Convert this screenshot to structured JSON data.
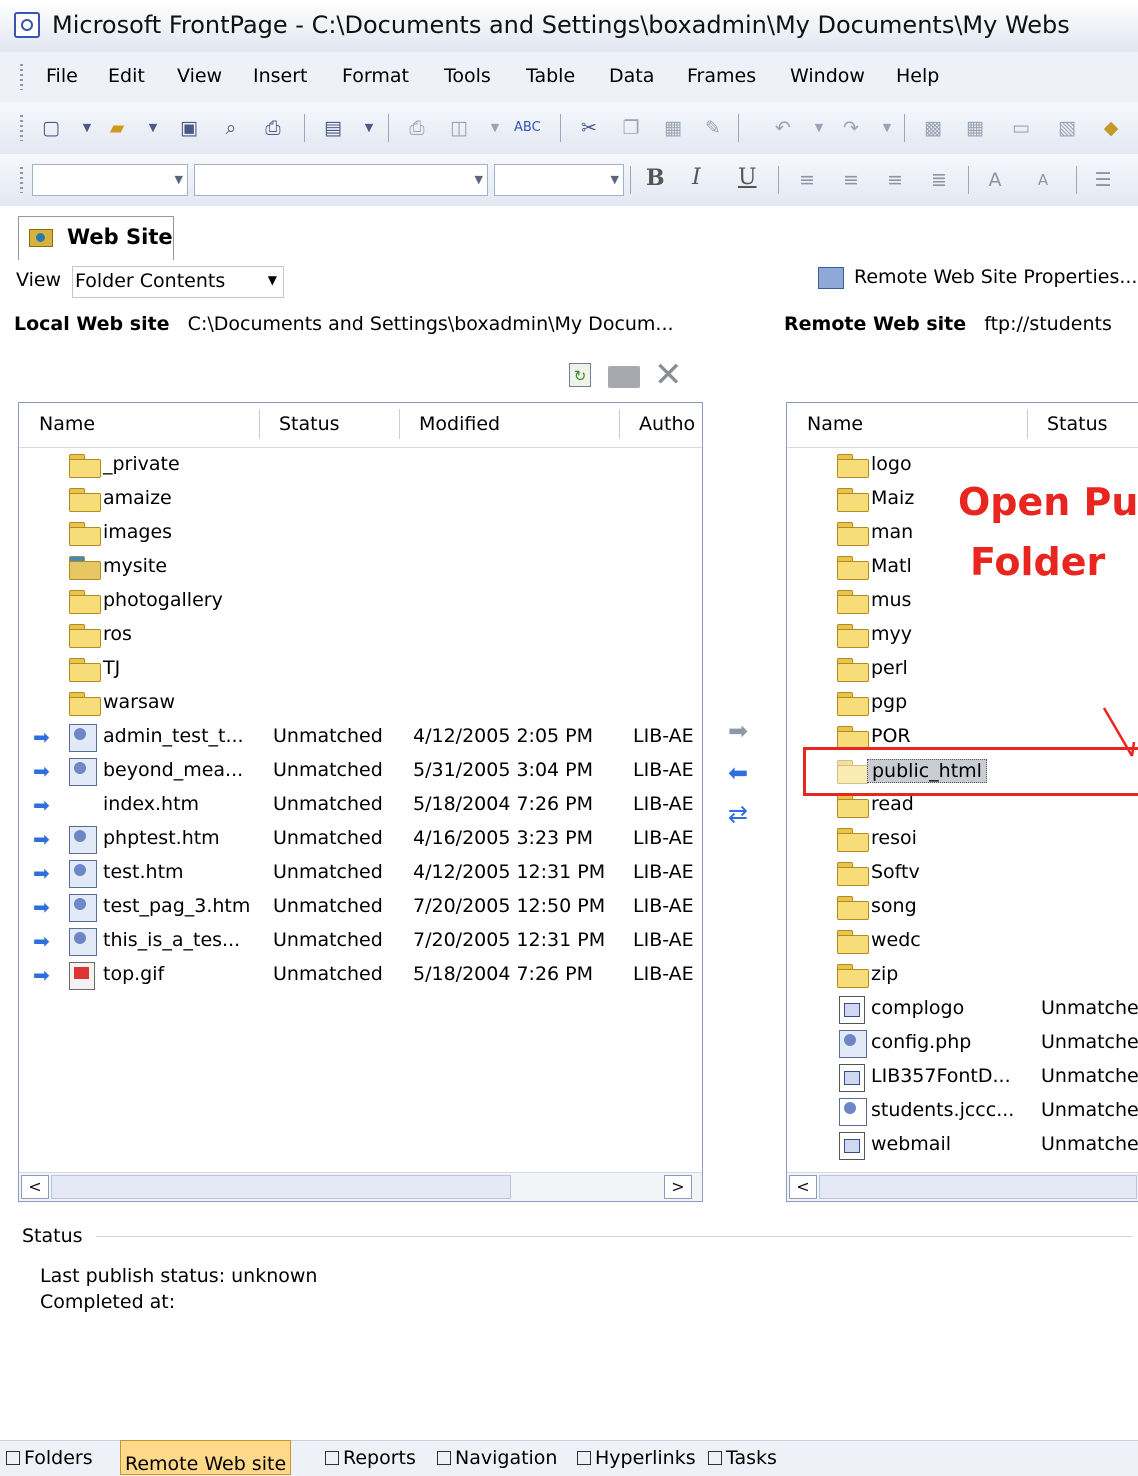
{
  "window": {
    "title": "Microsoft FrontPage - C:\\Documents and Settings\\boxadmin\\My Documents\\My Webs"
  },
  "menu": [
    "File",
    "Edit",
    "View",
    "Insert",
    "Format",
    "Tools",
    "Table",
    "Data",
    "Frames",
    "Window",
    "Help"
  ],
  "format_toolbar": {
    "bold": "B",
    "italic": "I",
    "underline": "U"
  },
  "tabs": {
    "web_site": "Web Site"
  },
  "view_row": {
    "label": "View",
    "selected": "Folder Contents",
    "remote_properties": "Remote Web Site Properties..."
  },
  "local_site": {
    "label": "Local Web site",
    "path": "C:\\Documents and Settings\\boxadmin\\My Docum...",
    "columns": [
      "Name",
      "Status",
      "Modified",
      "Autho"
    ],
    "folders": [
      "_private",
      "amaize",
      "images",
      "mysite",
      "photogallery",
      "ros",
      "TJ",
      "warsaw"
    ],
    "files": [
      {
        "name": "admin_test_t...",
        "status": "Unmatched",
        "modified": "4/12/2005 2:05 PM",
        "author": "LIB-AE",
        "icon": "page-icon"
      },
      {
        "name": "beyond_mea...",
        "status": "Unmatched",
        "modified": "5/31/2005 3:04 PM",
        "author": "LIB-AE",
        "icon": "page-icon"
      },
      {
        "name": "index.htm",
        "status": "Unmatched",
        "modified": "5/18/2004 7:26 PM",
        "author": "LIB-AE",
        "icon": "home-page-icon"
      },
      {
        "name": "phptest.htm",
        "status": "Unmatched",
        "modified": "4/16/2005 3:23 PM",
        "author": "LIB-AE",
        "icon": "page-icon"
      },
      {
        "name": "test.htm",
        "status": "Unmatched",
        "modified": "4/12/2005 12:31 PM",
        "author": "LIB-AE",
        "icon": "page-icon"
      },
      {
        "name": "test_pag_3.htm",
        "status": "Unmatched",
        "modified": "7/20/2005 12:50 PM",
        "author": "LIB-AE",
        "icon": "page-icon"
      },
      {
        "name": "this_is_a_tes...",
        "status": "Unmatched",
        "modified": "7/20/2005 12:31 PM",
        "author": "LIB-AE",
        "icon": "page-icon"
      },
      {
        "name": "top.gif",
        "status": "Unmatched",
        "modified": "5/18/2004 7:26 PM",
        "author": "LIB-AE",
        "icon": "gif-icon"
      }
    ]
  },
  "remote_site": {
    "label": "Remote Web site",
    "url": "ftp://students",
    "columns": [
      "Name",
      "Status"
    ],
    "folders": [
      "logo",
      "Maiz",
      "man",
      "Matl",
      "mus",
      "myy",
      "perl",
      "pgp",
      "POR",
      "public_html",
      "read",
      "resoi",
      "Softv",
      "song",
      "wedc",
      "zip"
    ],
    "selected_folder": "public_html",
    "files": [
      {
        "name": "complogo",
        "status": "Unmatche",
        "icon": "image-icon"
      },
      {
        "name": "config.php",
        "status": "Unmatche",
        "icon": "page-icon"
      },
      {
        "name": "LIB357FontD...",
        "status": "Unmatche",
        "icon": "image-icon"
      },
      {
        "name": "students.jccc...",
        "status": "Unmatche",
        "icon": "generic-file-icon"
      },
      {
        "name": "webmail",
        "status": "Unmatche",
        "icon": "image-icon"
      }
    ]
  },
  "annotation": {
    "line1": "Open Pu",
    "line2": "Folder",
    "color": "#e8251f"
  },
  "status": {
    "title": "Status",
    "last_publish": "Last publish status: unknown",
    "completed": "Completed at:"
  },
  "view_bar": [
    "Folders",
    "Remote Web site",
    "Reports",
    "Navigation",
    "Hyperlinks",
    "Tasks"
  ]
}
